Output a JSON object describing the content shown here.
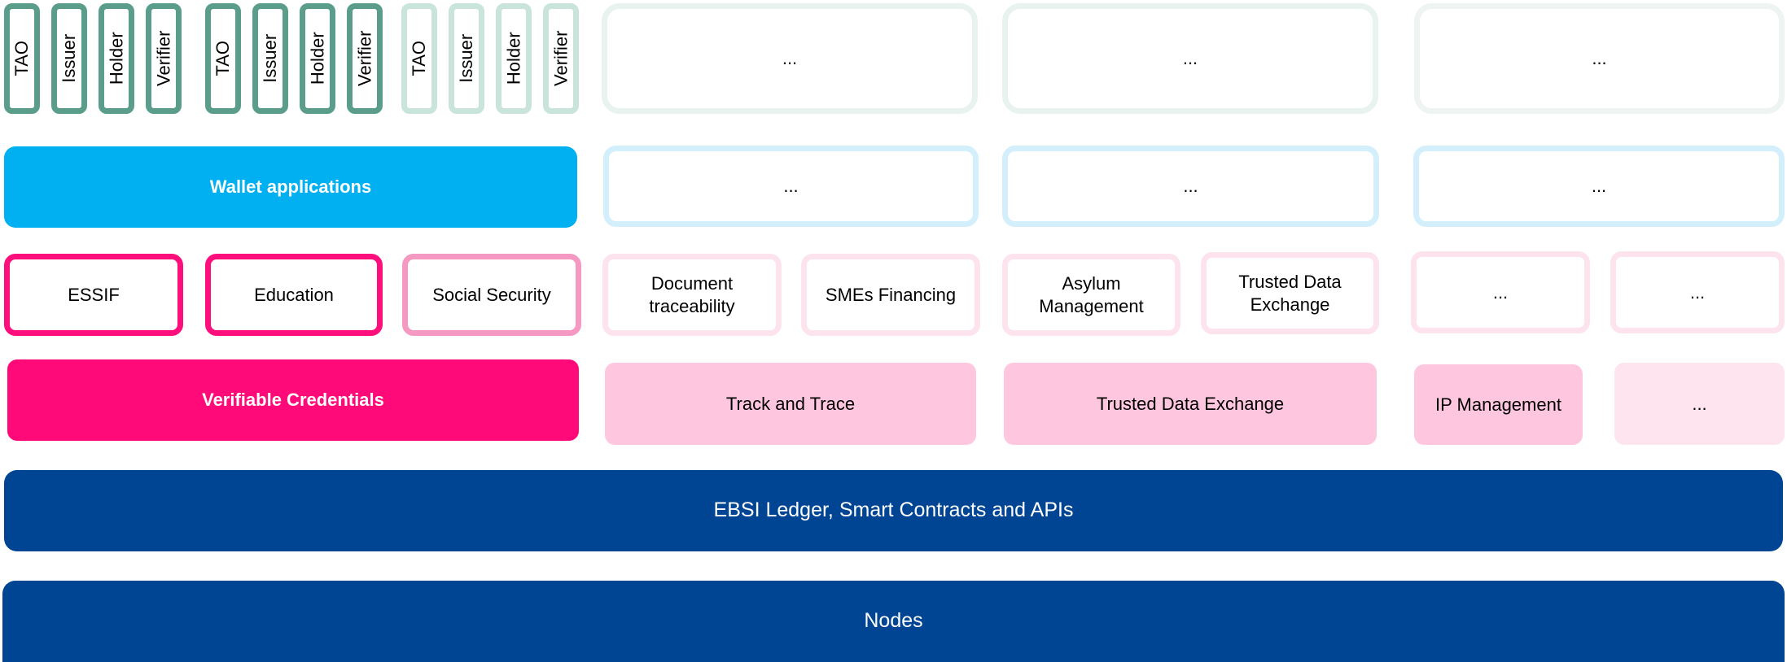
{
  "roles": {
    "group1": [
      "TAO",
      "Issuer",
      "Holder",
      "Verifier"
    ],
    "group2": [
      "TAO",
      "Issuer",
      "Holder",
      "Verifier"
    ],
    "group3": [
      "TAO",
      "Issuer",
      "Holder",
      "Verifier"
    ]
  },
  "ellipsis": "...",
  "wallet": {
    "label": "Wallet applications"
  },
  "use_cases": {
    "essif": "ESSIF",
    "education": "Education",
    "social_security": "Social Security",
    "document_traceability": "Document traceability",
    "smes_financing": "SMEs Financing",
    "asylum_management": "Asylum Management",
    "trusted_data_exchange": "Trusted Data Exchange"
  },
  "services": {
    "verifiable_credentials": "Verifiable Credentials",
    "track_and_trace": "Track and Trace",
    "trusted_data_exchange": "Trusted Data Exchange",
    "ip_management": "IP Management"
  },
  "infrastructure": {
    "ledger": "EBSI Ledger, Smart Contracts and APIs",
    "nodes": "Nodes"
  },
  "colors": {
    "green_dark": "#5a9d8a",
    "green_light": "#c9e4da",
    "cyan": "#00b0f0",
    "magenta": "#ff0a78",
    "pink_light": "#ffc7df",
    "navy": "#004494"
  }
}
